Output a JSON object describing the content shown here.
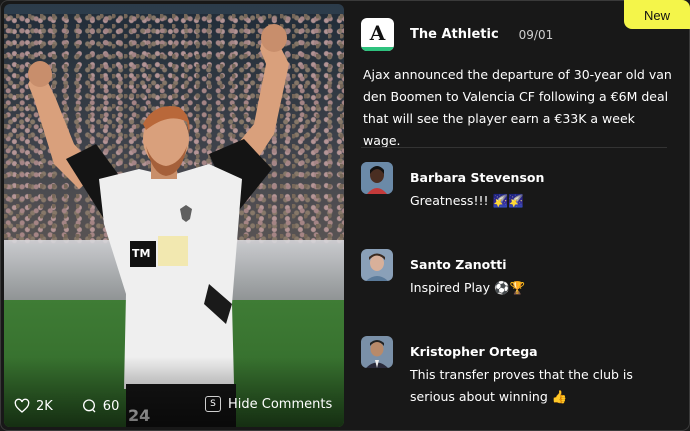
{
  "badge": {
    "label": "New"
  },
  "post": {
    "source_name": "The Athletic",
    "source_logo_letter": "A",
    "date": "09/01",
    "headline": "Ajax announced the departure of 30-year old van den Boomen to Valencia CF following a €6M deal that will see the player earn a €33K a week wage."
  },
  "photo": {
    "shirt_sponsor": "TM",
    "shirt_number": "24",
    "likes": "2K",
    "comments_count": "60",
    "hide_key": "S",
    "hide_label": "Hide Comments",
    "icons": {
      "likes": "heart-icon",
      "comments": "comment-bubble-icon"
    }
  },
  "comments": [
    {
      "name": "Barbara Stevenson",
      "text": "Greatness!!! 🌠🌠"
    },
    {
      "name": "Santo Zanotti",
      "text": "Inspired Play ⚽🏆"
    },
    {
      "name": "Kristopher Ortega",
      "text": "This transfer proves that the club is serious about winning 👍"
    }
  ],
  "colors": {
    "badge": "#f4f54a",
    "logo_bar": "#2ec27e",
    "panel": "#181818"
  }
}
